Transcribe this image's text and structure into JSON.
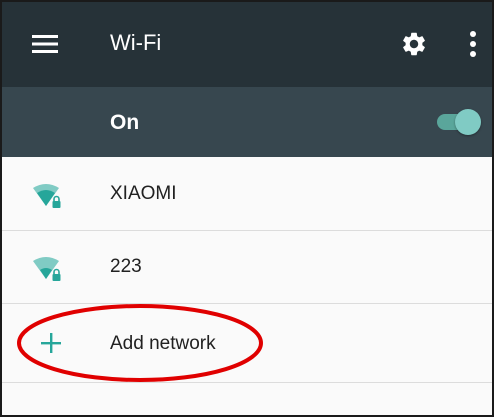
{
  "appbar": {
    "title": "Wi-Fi",
    "icons": [
      "menu-icon",
      "gear-icon",
      "more-vertical-icon"
    ],
    "bg_color": "#263238"
  },
  "master_switch": {
    "label": "On",
    "state": "on",
    "bg_color": "#37474f",
    "accent_color": "#80cbc4"
  },
  "networks": [
    {
      "ssid": "XIAOMI",
      "icon": "wifi-lock-icon"
    },
    {
      "ssid": "223",
      "icon": "wifi-lock-icon"
    }
  ],
  "add_network": {
    "label": "Add network",
    "icon": "plus-icon"
  },
  "annotation": {
    "shape": "ellipse",
    "color": "#e00000",
    "target": "add-network"
  }
}
